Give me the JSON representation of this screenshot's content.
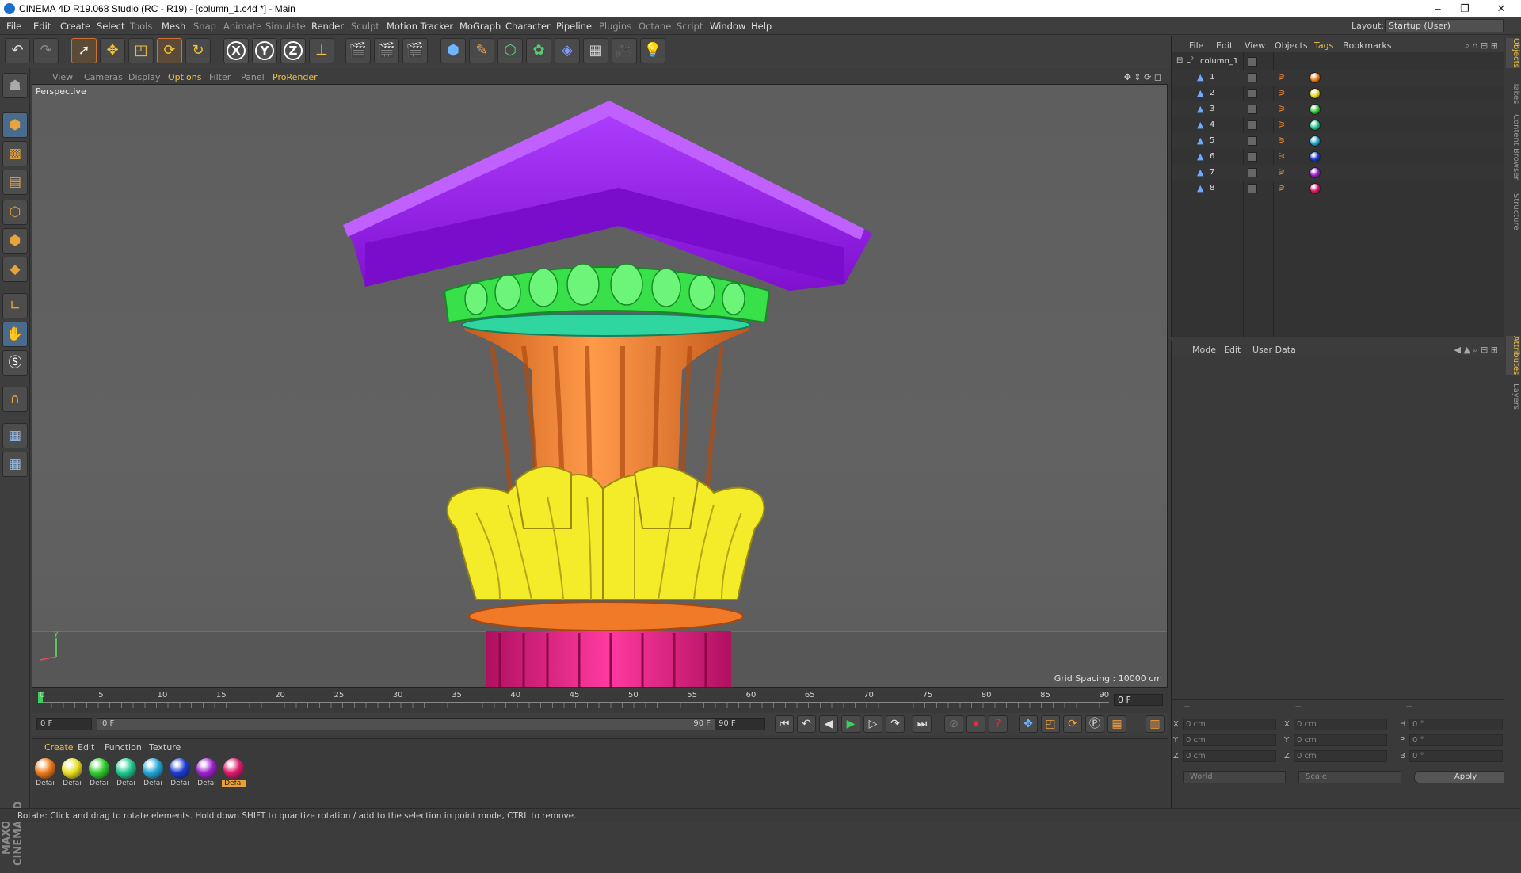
{
  "titlebar": {
    "title": "CINEMA 4D R19.068 Studio (RC - R19) - [column_1.c4d *] - Main",
    "minimize": "–",
    "restore": "❐",
    "close": "✕"
  },
  "menubar": {
    "items": [
      {
        "label": "File"
      },
      {
        "label": "Edit"
      },
      {
        "label": "Create"
      },
      {
        "label": "Select"
      },
      {
        "label": "Tools",
        "dim": true
      },
      {
        "label": "Mesh"
      },
      {
        "label": "Snap",
        "dim": true
      },
      {
        "label": "Animate",
        "dim": true
      },
      {
        "label": "Simulate",
        "dim": true
      },
      {
        "label": "Render"
      },
      {
        "label": "Sculpt",
        "dim": true
      },
      {
        "label": "Motion Tracker"
      },
      {
        "label": "MoGraph"
      },
      {
        "label": "Character"
      },
      {
        "label": "Pipeline"
      },
      {
        "label": "Plugins",
        "dim": true
      },
      {
        "label": "Octane",
        "dim": true
      },
      {
        "label": "Script",
        "dim": true
      },
      {
        "label": "Window"
      },
      {
        "label": "Help"
      }
    ],
    "layout_label": "Layout:",
    "layout_value": "Startup (User)"
  },
  "toolbar": {
    "undo": "↶",
    "redo": "↷",
    "x_axis": "X",
    "y_axis": "Y",
    "z_axis": "Z"
  },
  "viewport": {
    "menu": [
      "View",
      "Cameras",
      "Display",
      "Options",
      "Filter",
      "Panel",
      "ProRender"
    ],
    "highlight_menu": [
      "Options",
      "ProRender"
    ],
    "label": "Perspective",
    "grid_spacing": "Grid Spacing : 10000 cm",
    "colors": {
      "abacus": "#9a1fe0",
      "egg_dart": "#2fe84a",
      "bell": "#f28030",
      "acanthus": "#f5ef2a",
      "shaft": "#f01f8a",
      "bead": "#2fd6a0"
    }
  },
  "timeline": {
    "ticks": [
      "0",
      "5",
      "10",
      "15",
      "20",
      "25",
      "30",
      "35",
      "40",
      "45",
      "50",
      "55",
      "60",
      "65",
      "70",
      "75",
      "80",
      "85",
      "90"
    ],
    "current_frame": "0 F"
  },
  "transport": {
    "start_field": "0 F",
    "range_start": "0 F",
    "range_end": "90 F",
    "end_field": "90 F"
  },
  "materials": {
    "menu": [
      "Create",
      "Edit",
      "Function",
      "Texture"
    ],
    "items": [
      {
        "label": "Defai",
        "color": "#f07a1a"
      },
      {
        "label": "Defai",
        "color": "#e8e020"
      },
      {
        "label": "Defai",
        "color": "#30d030"
      },
      {
        "label": "Defai",
        "color": "#20c890"
      },
      {
        "label": "Defai",
        "color": "#20a8d8"
      },
      {
        "label": "Defai",
        "color": "#1a3ad0"
      },
      {
        "label": "Defai",
        "color": "#a020d0"
      },
      {
        "label": "Defai",
        "color": "#e0186a"
      }
    ]
  },
  "objects": {
    "menu": [
      "File",
      "Edit",
      "View",
      "Objects",
      "Tags",
      "Bookmarks"
    ],
    "root": "column_1",
    "rows": [
      {
        "name": "1",
        "color": "#f07a1a"
      },
      {
        "name": "2",
        "color": "#e8e020"
      },
      {
        "name": "3",
        "color": "#30d030"
      },
      {
        "name": "4",
        "color": "#20c890"
      },
      {
        "name": "5",
        "color": "#20a8d8"
      },
      {
        "name": "6",
        "color": "#1a3ad0"
      },
      {
        "name": "7",
        "color": "#a020d0"
      },
      {
        "name": "8",
        "color": "#e0186a"
      }
    ]
  },
  "attributes": {
    "menu": [
      "Mode",
      "Edit",
      "User Data"
    ]
  },
  "coordinates": {
    "header_a": "--",
    "header_b": "--",
    "header_c": "--",
    "rows": [
      {
        "a_lbl": "X",
        "a_val": "0 cm",
        "b_lbl": "X",
        "b_val": "0 cm",
        "c_lbl": "H",
        "c_val": "0 °"
      },
      {
        "a_lbl": "Y",
        "a_val": "0 cm",
        "b_lbl": "Y",
        "b_val": "0 cm",
        "c_lbl": "P",
        "c_val": "0 °"
      },
      {
        "a_lbl": "Z",
        "a_val": "0 cm",
        "b_lbl": "Z",
        "b_val": "0 cm",
        "c_lbl": "B",
        "c_val": "0 °"
      }
    ],
    "world": "World",
    "scale": "Scale",
    "apply": "Apply"
  },
  "righttabs": [
    "Objects",
    "Takes",
    "Content Browser",
    "Structure",
    "Attributes",
    "Layers"
  ],
  "status": "Rotate: Click and drag to rotate elements. Hold down SHIFT to quantize rotation / add to the selection in point mode, CTRL to remove.",
  "logo": "MAXON CINEMA 4D"
}
